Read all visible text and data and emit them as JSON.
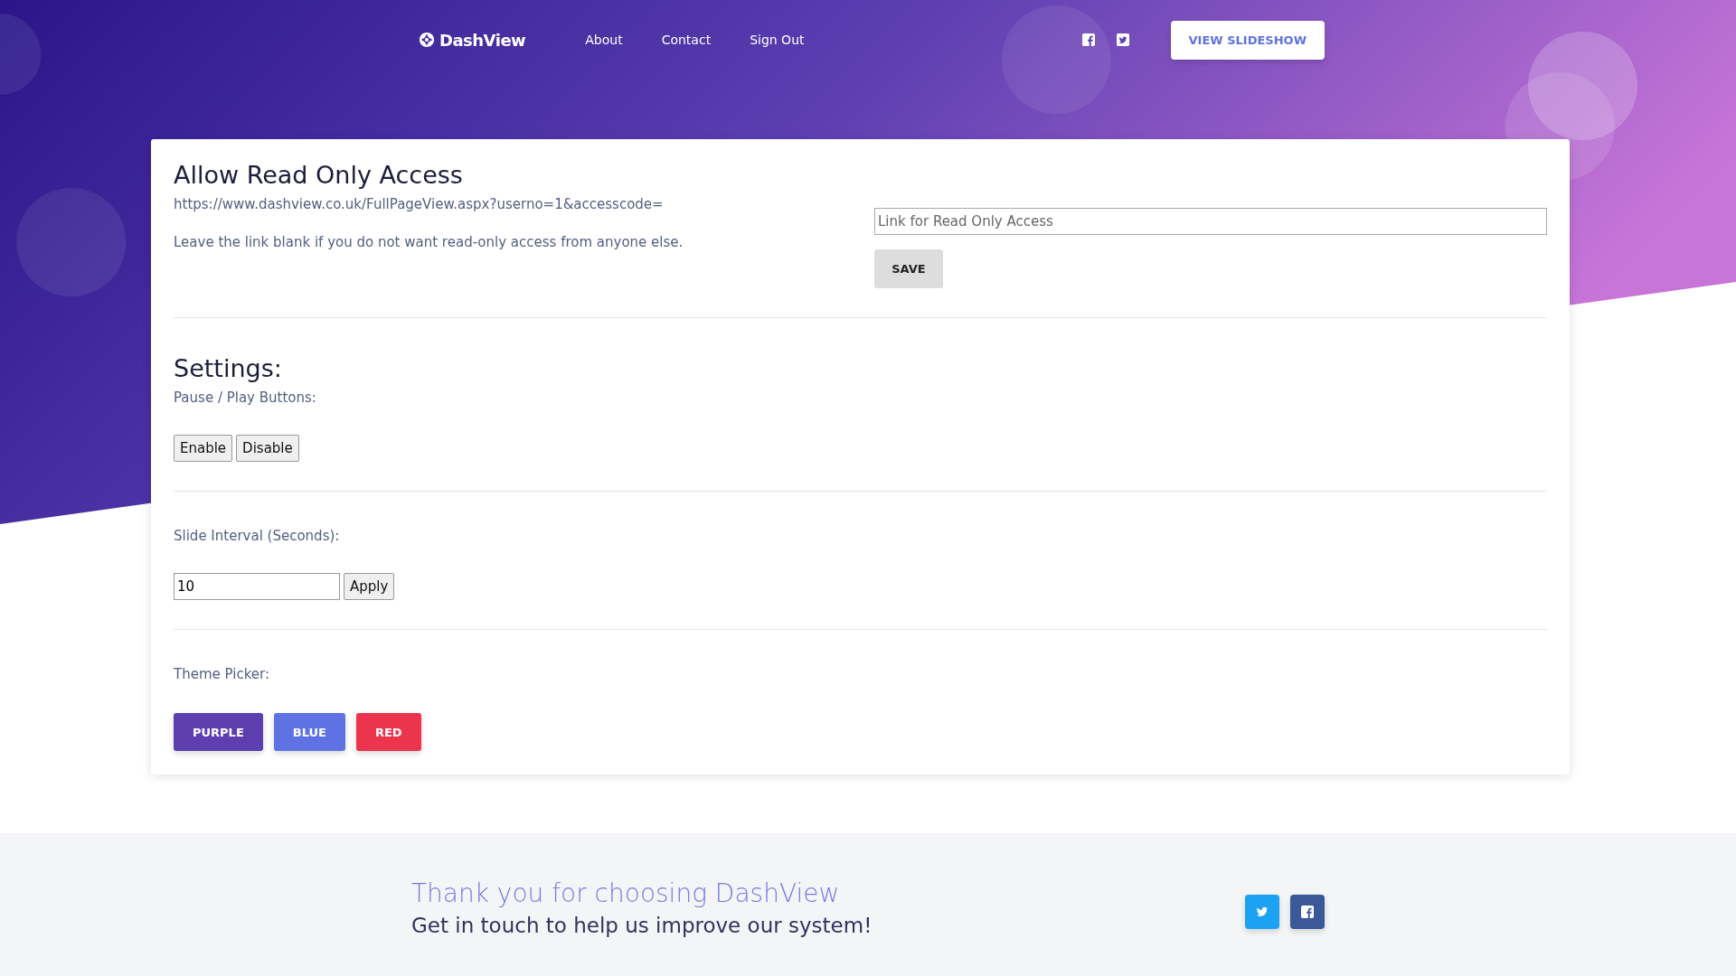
{
  "nav": {
    "brand": "DashView",
    "links": [
      "About",
      "Contact",
      "Sign Out"
    ],
    "cta": "VIEW SLIDESHOW"
  },
  "access": {
    "title": "Allow Read Only Access",
    "url": "https://www.dashview.co.uk/FullPageView.aspx?userno=1&accesscode=",
    "note": "Leave the link blank if you do not want read-only access from anyone else.",
    "placeholder": "Link for Read Only Access",
    "save": "SAVE"
  },
  "settings": {
    "title": "Settings:",
    "pause_label": "Pause / Play Buttons:",
    "pause_buttons": [
      "Enable",
      "Disable"
    ],
    "interval_label": "Slide Interval (Seconds):",
    "interval_value": "10",
    "apply": "Apply",
    "theme_label": "Theme Picker:",
    "themes": [
      {
        "label": "PURPLE",
        "color": "#5e3fb0"
      },
      {
        "label": "BLUE",
        "color": "#5e72e4"
      },
      {
        "label": "RED",
        "color": "#ec344c"
      }
    ]
  },
  "footer": {
    "title": "Thank you for choosing DashView",
    "subtitle": "Get in touch to help us improve our system!"
  }
}
